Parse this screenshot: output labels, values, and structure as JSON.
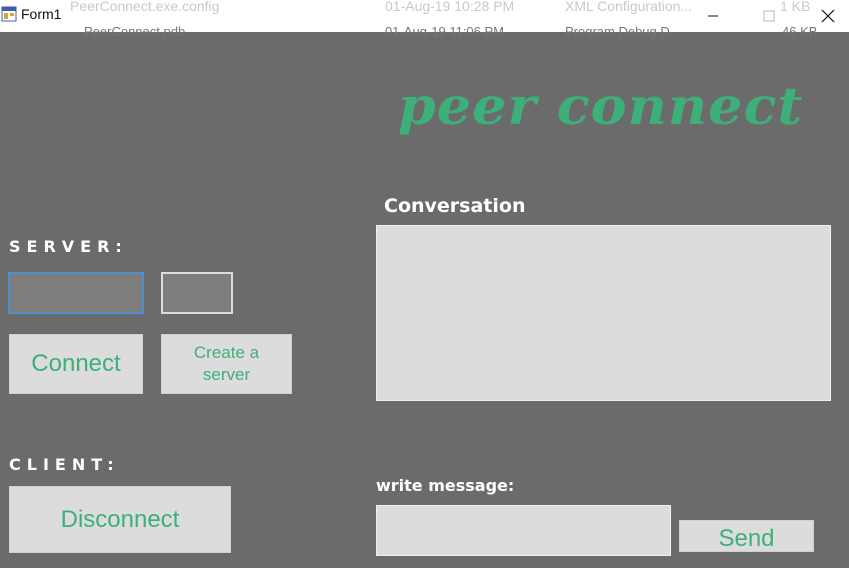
{
  "window": {
    "title": "Form1",
    "background_text": {
      "file1": "PeerConnect.exe.config",
      "date1": "01-Aug-19 10:28 PM",
      "type1": "XML Configuration...",
      "size1": "1 KB",
      "file2": "PeerConnect.pdb",
      "date2": "01-Aug-19 11:06 PM",
      "type2": "Program Debug D...",
      "size2": "46 KB"
    }
  },
  "logo": {
    "text": "peer connect"
  },
  "server": {
    "label": "SERVER:",
    "ip_value": "",
    "port_value": "",
    "connect_label": "Connect",
    "create_label": "Create a server"
  },
  "client": {
    "label": "CLIENT:",
    "disconnect_label": "Disconnect"
  },
  "conversation": {
    "label": "Conversation",
    "content": ""
  },
  "message": {
    "label": "write message:",
    "value": "",
    "send_label": "Send"
  },
  "colors": {
    "accent": "#3db07a",
    "form_bg": "#6b6b6b",
    "control_bg": "#dcdcdc"
  }
}
